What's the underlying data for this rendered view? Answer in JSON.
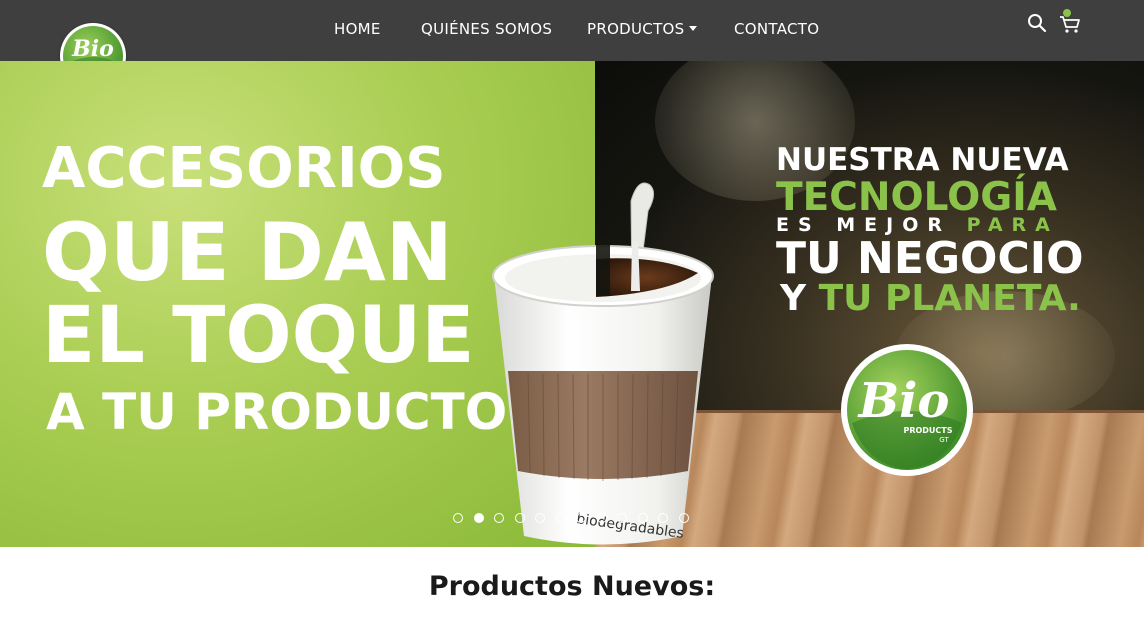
{
  "nav": {
    "home": "HOME",
    "about": "QUIÉNES SOMOS",
    "products": "PRODUCTOS",
    "contact": "CONTACTO"
  },
  "icons": {
    "search": "search-icon",
    "cart": "cart-icon"
  },
  "logo": {
    "text": "Bio",
    "sub": "PRODUCTS",
    "suffix": "GT"
  },
  "hero": {
    "left_lines": [
      "ACCESORIOS",
      "QUE DAN",
      "EL TOQUE",
      "A TU PRODUCTO"
    ],
    "right_line1": "NUESTRA NUEVA",
    "right_line2": "TECNOLOGÍA",
    "right_line3a": "ES MEJOR",
    "right_line3b": "PARA",
    "right_line4": "TU NEGOCIO",
    "right_line5a": "Y",
    "right_line5b": "TU PLANETA.",
    "cup_label": "biodegradables",
    "badge_text": "Bio",
    "badge_sub": "PRODUCTS",
    "badge_suffix": "GT"
  },
  "slider": {
    "count": 12,
    "active_index": 1
  },
  "colors": {
    "header_bg": "#3f3f3f",
    "brand_green": "#6cb33f",
    "light_green": "#a9cd52"
  },
  "section": {
    "title": "Productos Nuevos:"
  }
}
